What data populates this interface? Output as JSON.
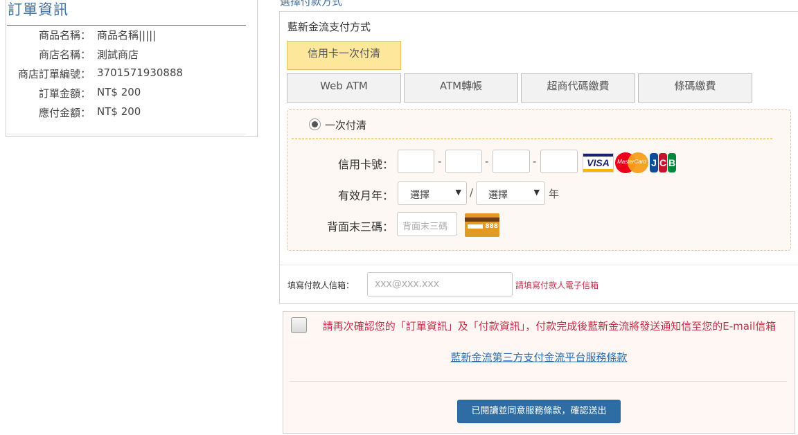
{
  "order": {
    "title": "訂單資訊",
    "rows": [
      {
        "label": "商品名稱：",
        "value": "商品名稱|||||"
      },
      {
        "label": "商店名稱：",
        "value": "測試商店"
      },
      {
        "label": "商店訂單編號：",
        "value": "3701571930888"
      },
      {
        "label": "訂單金額：",
        "value": "NT$ 200"
      },
      {
        "label": "應付金額：",
        "value": "NT$ 200"
      }
    ]
  },
  "payment": {
    "heading": "選擇付款方式",
    "subheading": "藍新金流支付方式",
    "tabs": [
      {
        "label": "信用卡一次付清",
        "active": true
      },
      {
        "label": "Web ATM",
        "active": false
      },
      {
        "label": "ATM轉帳",
        "active": false
      },
      {
        "label": "超商代碼繳費",
        "active": false
      },
      {
        "label": "條碼繳費",
        "active": false
      }
    ],
    "option_label": "一次付清",
    "card_number_label": "信用卡號：",
    "card_sep": "-",
    "expiry_label": "有效月年：",
    "month_select": "選擇",
    "year_select": "選擇",
    "expiry_sep": "/",
    "year_suffix": "年",
    "cvc_label": "背面末三碼：",
    "cvc_placeholder": "背面末三碼",
    "cvc_card_number": "888",
    "logos": {
      "visa": "VISA",
      "mastercard": "MasterCard",
      "jcb": [
        "J",
        "C",
        "B"
      ]
    },
    "email_label": "填寫付款人信箱：",
    "email_placeholder": "xxx@xxx.xxx",
    "email_hint": "請填寫付款人電子信箱"
  },
  "confirm": {
    "text": "請再次確認您的「訂單資訊」及「付款資訊」，付款完成後藍新金流將發送通知信至您的E-mail信箱",
    "terms_link": "藍新金流第三方支付金流平台服務條款",
    "submit_label": "已閱讀並同意服務條款，確認送出"
  },
  "colors": {
    "accent_blue": "#3a6ea5",
    "active_tab": "#fde79a",
    "warning_red": "#c0304a",
    "submit_blue": "#2e6da4"
  }
}
